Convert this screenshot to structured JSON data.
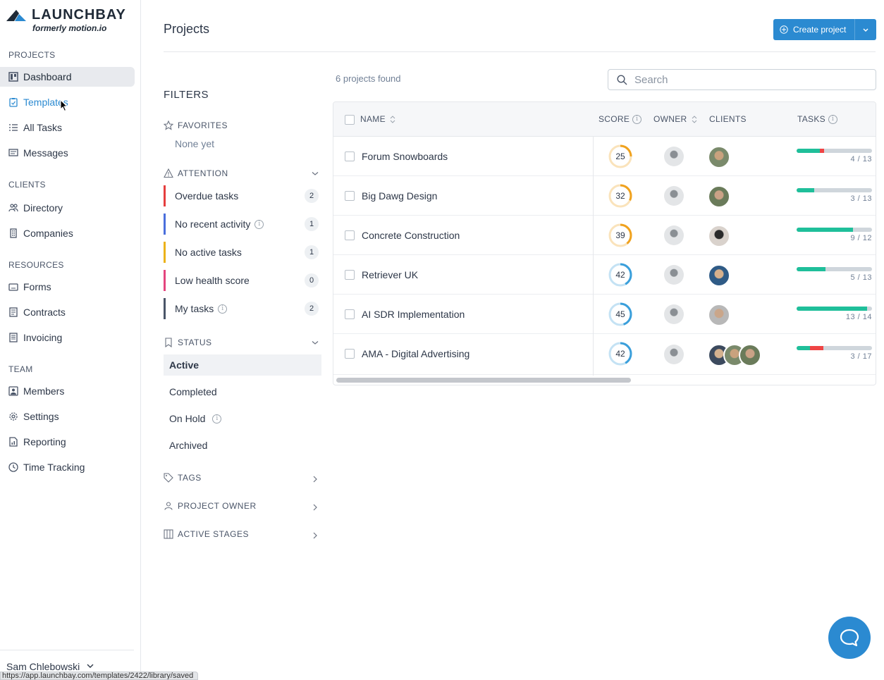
{
  "brand": {
    "name": "LAUNCHBAY",
    "tagline": "formerly motion.io",
    "color": "#2b8ad1"
  },
  "sidebar": {
    "sections": [
      {
        "title": "PROJECTS",
        "items": [
          {
            "label": "Dashboard",
            "icon": "dashboard-icon"
          },
          {
            "label": "Templates",
            "icon": "clipboard-icon"
          },
          {
            "label": "All Tasks",
            "icon": "list-icon"
          },
          {
            "label": "Messages",
            "icon": "message-icon"
          }
        ]
      },
      {
        "title": "CLIENTS",
        "items": [
          {
            "label": "Directory",
            "icon": "users-icon"
          },
          {
            "label": "Companies",
            "icon": "building-icon"
          }
        ]
      },
      {
        "title": "RESOURCES",
        "items": [
          {
            "label": "Forms",
            "icon": "form-icon"
          },
          {
            "label": "Contracts",
            "icon": "document-icon"
          },
          {
            "label": "Invoicing",
            "icon": "invoice-icon"
          }
        ]
      },
      {
        "title": "TEAM",
        "items": [
          {
            "label": "Members",
            "icon": "member-icon"
          },
          {
            "label": "Settings",
            "icon": "gear-icon"
          },
          {
            "label": "Reporting",
            "icon": "report-icon"
          },
          {
            "label": "Time Tracking",
            "icon": "clock-icon"
          }
        ]
      }
    ],
    "user": "Sam Chlebowski",
    "status_url": "https://app.launchbay.com/templates/2422/library/saved"
  },
  "header": {
    "title": "Projects",
    "create_label": "Create project"
  },
  "filters": {
    "title": "FILTERS",
    "favorites": {
      "label": "FAVORITES",
      "empty": "None yet"
    },
    "attention": {
      "label": "ATTENTION",
      "items": [
        {
          "label": "Overdue tasks",
          "count": "2",
          "color": "#e53e3e"
        },
        {
          "label": "No recent activity",
          "count": "1",
          "color": "#4a6fdc"
        },
        {
          "label": "No active tasks",
          "count": "1",
          "color": "#ecb21a"
        },
        {
          "label": "Low health score",
          "count": "0",
          "color": "#e4457e"
        },
        {
          "label": "My tasks",
          "count": "2",
          "color": "#4a5568"
        }
      ]
    },
    "status": {
      "label": "STATUS",
      "items": [
        "Active",
        "Completed",
        "On Hold",
        "Archived"
      ]
    },
    "tags": "TAGS",
    "project_owner": "PROJECT OWNER",
    "active_stages": "ACTIVE STAGES"
  },
  "results": {
    "count_label": "6 projects found",
    "search_placeholder": "Search"
  },
  "table": {
    "columns": [
      "NAME",
      "SCORE",
      "OWNER",
      "CLIENTS",
      "TASKS"
    ],
    "rows": [
      {
        "name": "Forum Snowboards",
        "score": "25",
        "score_fraction": 0.25,
        "score_color": "#f0a21e",
        "tasks": "4 / 13",
        "done_fraction": 0.31,
        "overdue_fraction": 0.06,
        "clients": 1
      },
      {
        "name": "Big Dawg Design",
        "score": "32",
        "score_fraction": 0.32,
        "score_color": "#f0a21e",
        "tasks": "3 / 13",
        "done_fraction": 0.23,
        "overdue_fraction": 0,
        "clients": 1
      },
      {
        "name": "Concrete Construction",
        "score": "39",
        "score_fraction": 0.39,
        "score_color": "#f0a21e",
        "tasks": "9 / 12",
        "done_fraction": 0.75,
        "overdue_fraction": 0,
        "clients": 1
      },
      {
        "name": "Retriever UK",
        "score": "42",
        "score_fraction": 0.42,
        "score_color": "#3a9fdb",
        "tasks": "5 / 13",
        "done_fraction": 0.38,
        "overdue_fraction": 0,
        "clients": 1
      },
      {
        "name": "AI SDR Implementation",
        "score": "45",
        "score_fraction": 0.45,
        "score_color": "#3a9fdb",
        "tasks": "13 / 14",
        "done_fraction": 0.93,
        "overdue_fraction": 0,
        "clients": 1
      },
      {
        "name": "AMA - Digital Advertising",
        "score": "42",
        "score_fraction": 0.42,
        "score_color": "#3a9fdb",
        "tasks": "3 / 17",
        "done_fraction": 0.18,
        "overdue_fraction": 0.18,
        "clients": 3
      }
    ],
    "colors": {
      "done": "#1fbf9a",
      "overdue": "#ef4444",
      "track": "#cfd6dc"
    }
  }
}
